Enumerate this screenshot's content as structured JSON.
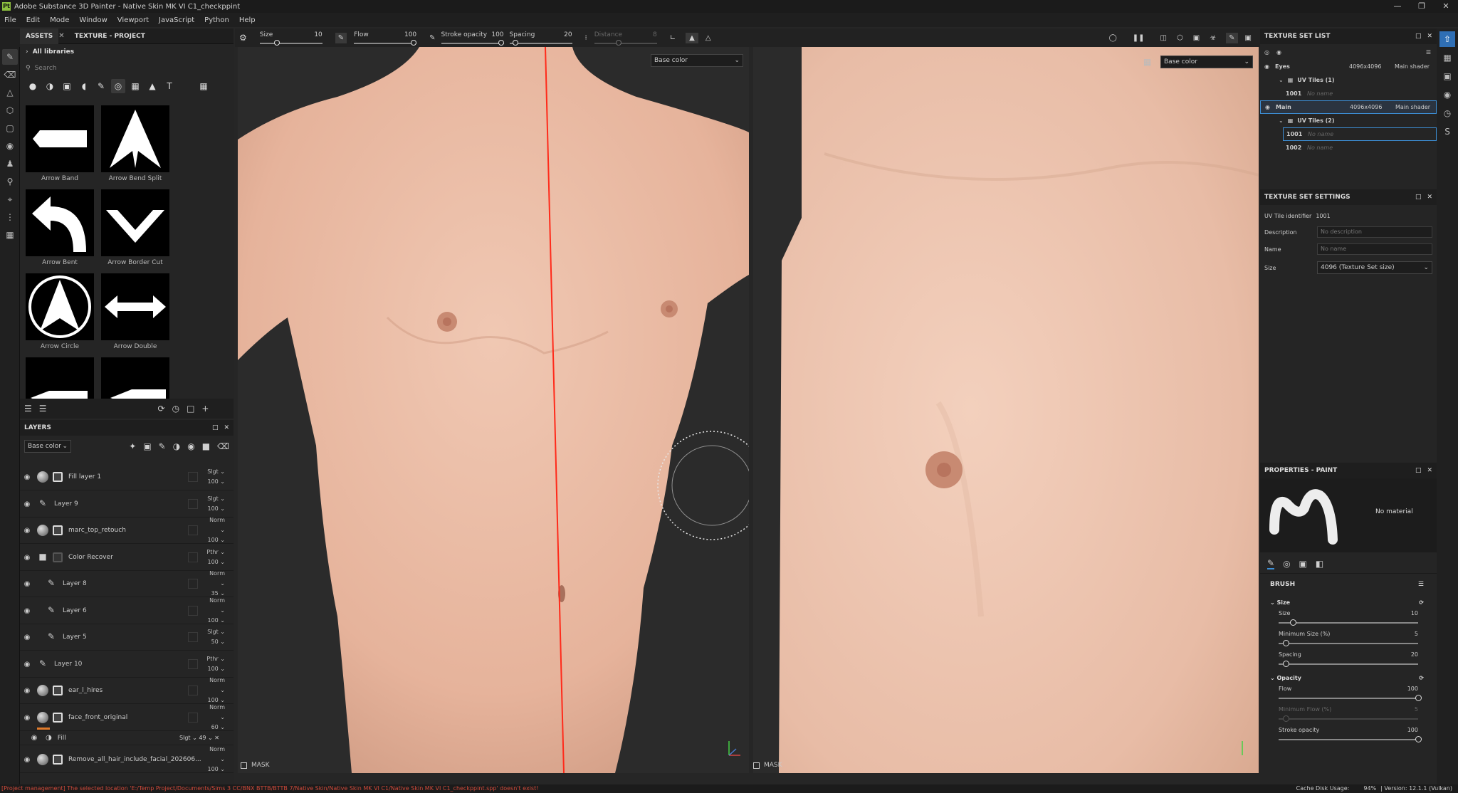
{
  "app": {
    "title": "Adobe Substance 3D Painter - Native Skin MK VI C1_checkppint",
    "logo": "Pt"
  },
  "menu": [
    "File",
    "Edit",
    "Mode",
    "Window",
    "Viewport",
    "JavaScript",
    "Python",
    "Help"
  ],
  "assets": {
    "tabs": [
      "ASSETS",
      "TEXTURE - PROJECT"
    ],
    "library": "All libraries",
    "search_placeholder": "Search",
    "items": [
      "Arrow Band",
      "Arrow Bend Split",
      "Arrow Bent",
      "Arrow Border Cut",
      "Arrow Circle",
      "Arrow Double"
    ]
  },
  "toolbar": {
    "size_label": "Size",
    "size_value": "10",
    "flow_label": "Flow",
    "flow_value": "100",
    "stroke_label": "Stroke opacity",
    "stroke_value": "100",
    "spacing_label": "Spacing",
    "spacing_value": "20",
    "distance_label": "Distance",
    "distance_value": "8"
  },
  "viewport": {
    "channel_left": "Base color",
    "channel_right": "Base color",
    "mask_label": "MASK"
  },
  "layers": {
    "title": "LAYERS",
    "channel": "Base color",
    "items": [
      {
        "name": "Fill layer 1",
        "blend": "Slgt",
        "opacity": "100",
        "kind": "fill"
      },
      {
        "name": "Layer 9",
        "blend": "Slgt",
        "opacity": "100",
        "kind": "paint"
      },
      {
        "name": "marc_top_retouch",
        "blend": "Norm",
        "opacity": "100",
        "kind": "fill"
      },
      {
        "name": "Color Recover",
        "blend": "Pthr",
        "opacity": "100",
        "kind": "folder"
      },
      {
        "name": "Layer 8",
        "blend": "Norm",
        "opacity": "35",
        "kind": "paint"
      },
      {
        "name": "Layer 6",
        "blend": "Norm",
        "opacity": "100",
        "kind": "paint"
      },
      {
        "name": "Layer 5",
        "blend": "Slgt",
        "opacity": "50",
        "kind": "paint"
      },
      {
        "name": "Layer 10",
        "blend": "Pthr",
        "opacity": "100",
        "kind": "paint"
      },
      {
        "name": "ear_l_hires",
        "blend": "Norm",
        "opacity": "100",
        "kind": "fill"
      },
      {
        "name": "face_front_original",
        "blend": "Norm",
        "opacity": "60",
        "kind": "fill"
      }
    ],
    "fill_effect": {
      "name": "Fill",
      "blend": "Slgt",
      "opacity": "49"
    },
    "last_layer": {
      "name": "Remove_all_hair_include_facial_202606...",
      "blend": "Norm",
      "opacity": "100"
    }
  },
  "texture_set_list": {
    "title": "TEXTURE SET LIST",
    "sets": [
      {
        "name": "Eyes",
        "res": "4096x4096",
        "shader": "Main shader",
        "uv": "UV Tiles (1)",
        "tiles": [
          {
            "id": "1001",
            "name": "No name"
          }
        ]
      },
      {
        "name": "Main",
        "res": "4096x4096",
        "shader": "Main shader",
        "uv": "UV Tiles (2)",
        "tiles": [
          {
            "id": "1001",
            "name": "No name"
          },
          {
            "id": "1002",
            "name": "No name"
          }
        ]
      }
    ]
  },
  "texture_set_settings": {
    "title": "TEXTURE SET SETTINGS",
    "uv_tile_label": "UV Tile identifier",
    "uv_tile_value": "1001",
    "description_label": "Description",
    "description_placeholder": "No description",
    "name_label": "Name",
    "name_placeholder": "No name",
    "size_label": "Size",
    "size_value": "4096 (Texture Set size)"
  },
  "properties": {
    "title": "PROPERTIES - PAINT",
    "material": "No material",
    "brush_title": "BRUSH",
    "size_group": "Size",
    "size_label": "Size",
    "size_value": "10",
    "size_level": 0.1,
    "min_size_label": "Minimum Size (%)",
    "min_size_value": "5",
    "min_size_level": 0.05,
    "spacing_label": "Spacing",
    "spacing_value": "20",
    "spacing_level": 0.05,
    "opacity_group": "Opacity",
    "flow_label": "Flow",
    "flow_value": "100",
    "flow_level": 1.0,
    "min_flow_label": "Minimum Flow (%)",
    "min_flow_value": "5",
    "min_flow_level": 0.05,
    "stroke_label": "Stroke opacity",
    "stroke_value": "100",
    "stroke_level": 1.0
  },
  "status": {
    "error": "[Project management] The selected location 'E:/Temp Project/Documents/Sims 3 CC/BNX BTTB/BTTB 7/Native Skin/Native Skin MK VI C1/Native Skin MK VI C1_checkppint.spp' doesn't exist!",
    "cache_label": "Cache Disk Usage:",
    "cache_value": "94%",
    "version": "Version: 12.1.1 (Vulkan)"
  },
  "colors": {
    "accent": "#3d8fd6",
    "error": "#d04a3a",
    "skin": "#e8b9a2"
  }
}
